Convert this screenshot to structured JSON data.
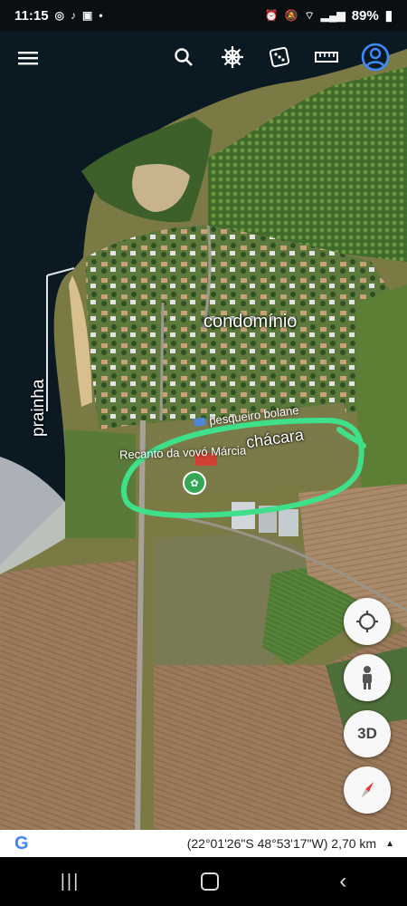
{
  "status_bar": {
    "time": "11:15",
    "battery": "89%"
  },
  "toolbar": {
    "icons": [
      "menu-icon",
      "search-icon",
      "ship-wheel-icon",
      "dice-icon",
      "ruler-icon",
      "account-icon"
    ]
  },
  "map": {
    "labels": {
      "condominio": "condomínio",
      "prainha": "prainha",
      "chacara": "chácara"
    },
    "pois": {
      "pesqueiro": "pesqueiro bolane",
      "recanto": "Recanto da vovó Márcia"
    },
    "highlight_color": "#3ee08a"
  },
  "side_controls": {
    "view_3d_label": "3D"
  },
  "bottom_bar": {
    "logo": "G",
    "coordinates": "(22°01'26\"S 48°53'17\"W) 2,70 km"
  },
  "nav_bar": {
    "icons": [
      "recents-icon",
      "home-icon",
      "back-icon"
    ]
  }
}
